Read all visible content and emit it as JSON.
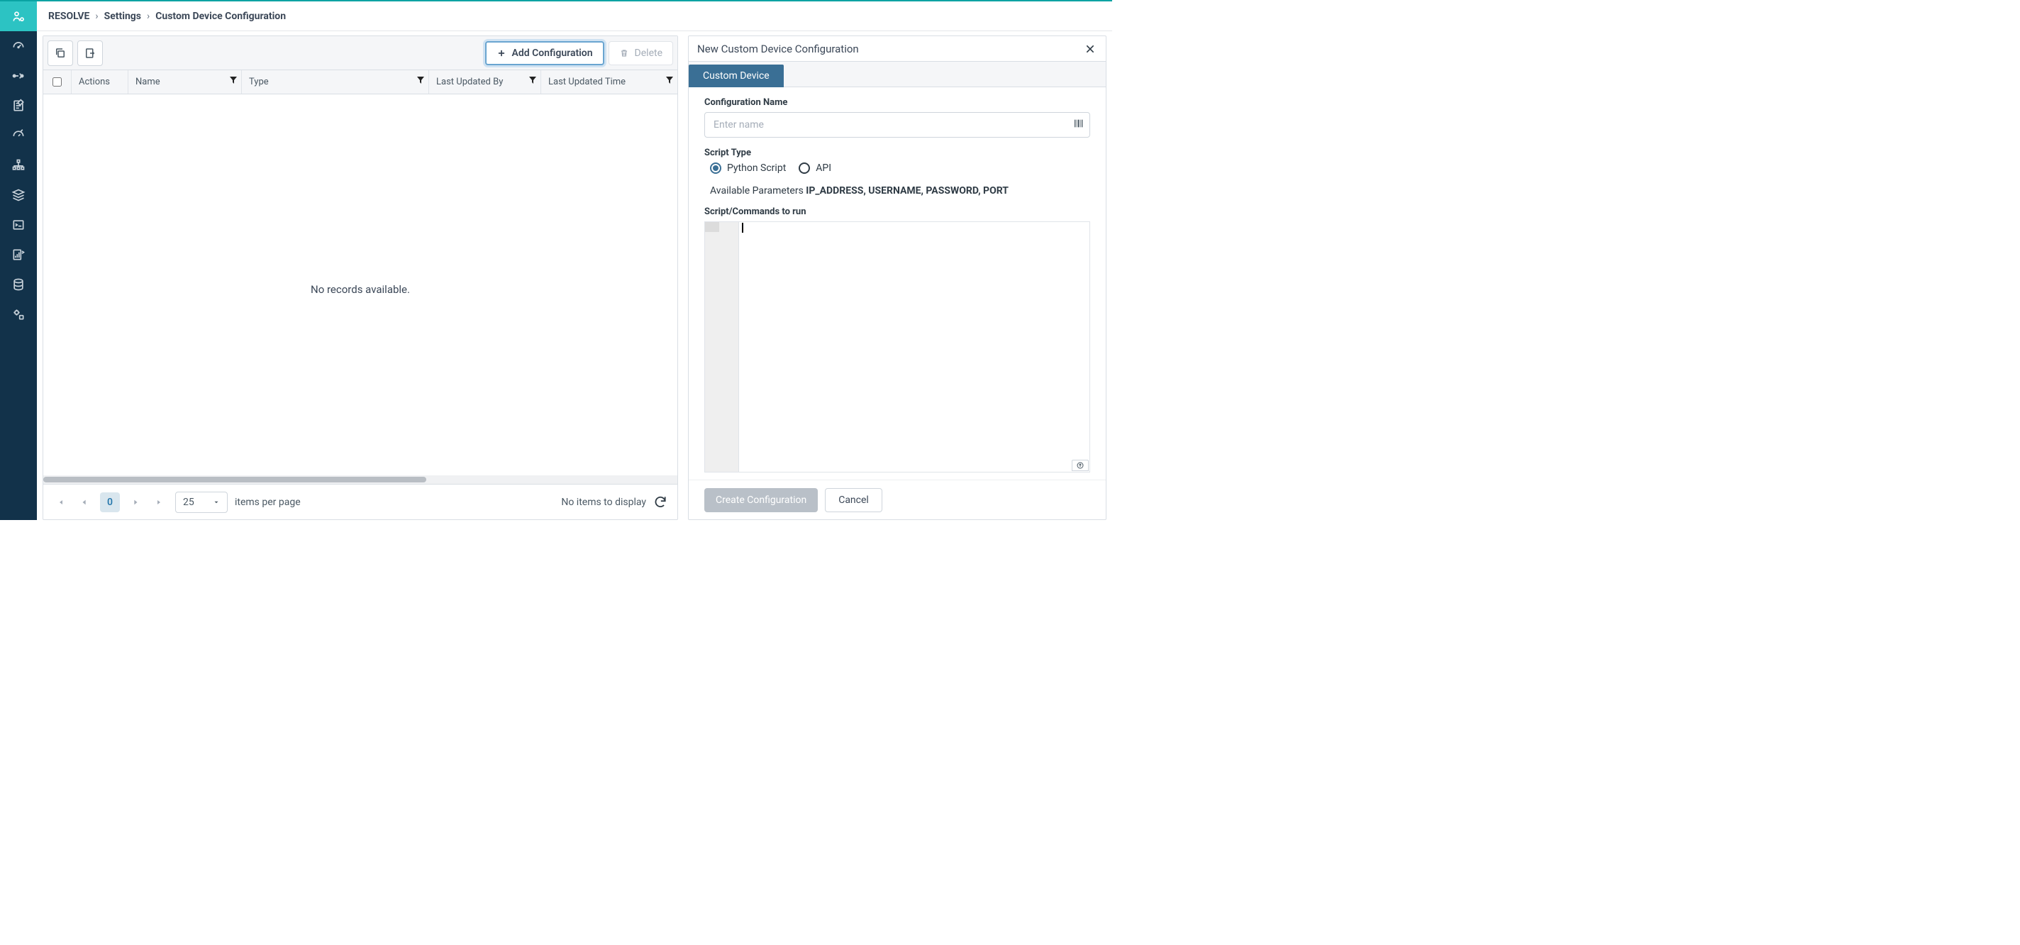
{
  "breadcrumb": {
    "app": "RESOLVE",
    "section": "Settings",
    "page": "Custom Device Configuration"
  },
  "toolbar": {
    "add_label": "Add Configuration",
    "delete_label": "Delete"
  },
  "table": {
    "columns": [
      "Actions",
      "Name",
      "Type",
      "Last Updated By",
      "Last Updated Time"
    ],
    "empty_message": "No records available."
  },
  "pager": {
    "page": "0",
    "page_size": "25",
    "per_page_label": "items per page",
    "status": "No items to display"
  },
  "side": {
    "title": "New Custom Device Configuration",
    "tab": "Custom Device",
    "config_name_label": "Configuration Name",
    "config_name_placeholder": "Enter name",
    "script_type_label": "Script Type",
    "script_type_options": {
      "python": "Python Script",
      "api": "API"
    },
    "available_params_label": "Available Parameters",
    "available_params_value": "IP_ADDRESS, USERNAME, PASSWORD, PORT",
    "script_label": "Script/Commands to run",
    "create_label": "Create Configuration",
    "cancel_label": "Cancel"
  }
}
